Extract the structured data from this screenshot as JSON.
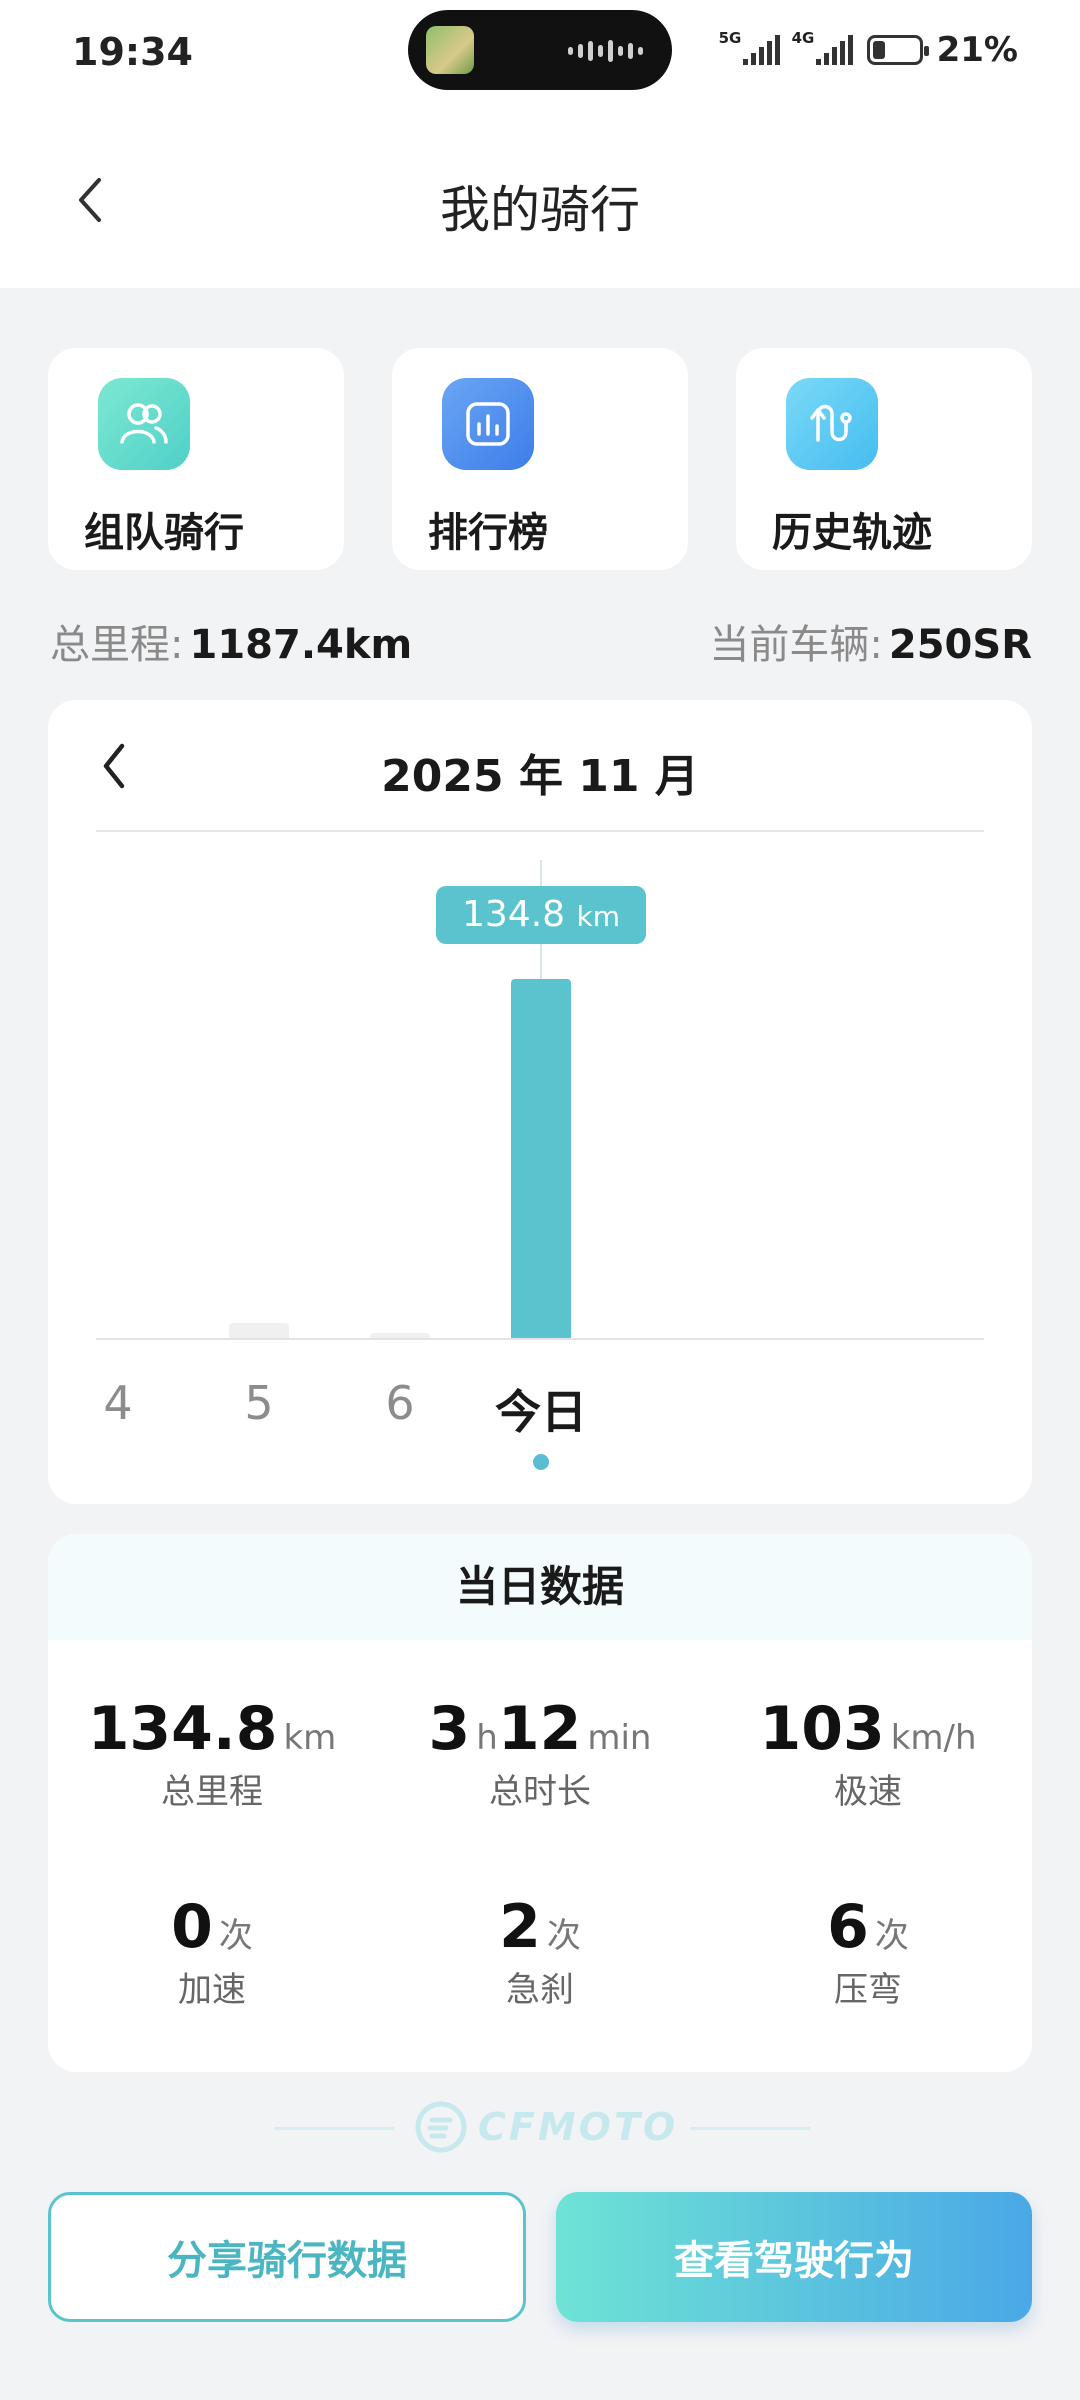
{
  "status": {
    "time": "19:34",
    "net1": "5G",
    "net2": "4G",
    "battery": "21%"
  },
  "header": {
    "title": "我的骑行"
  },
  "quick_actions": [
    {
      "label": "组队骑行",
      "icon": "team-ride-icon",
      "color": "#5fdcc9"
    },
    {
      "label": "排行榜",
      "icon": "leaderboard-icon",
      "color": "#4a8ef0"
    },
    {
      "label": "历史轨迹",
      "icon": "track-history-icon",
      "color": "#5cc8f0"
    }
  ],
  "totals": {
    "mileage_label": "总里程:",
    "mileage_value": "1187.4km",
    "vehicle_label": "当前车辆:",
    "vehicle_value": "250SR"
  },
  "chart_data": {
    "type": "bar",
    "title": "2025 年 11 月",
    "categories": [
      "4",
      "5",
      "6",
      "今日"
    ],
    "values": [
      0,
      5.5,
      2,
      134.8
    ],
    "selected_index": 3,
    "tooltip_value": "134.8",
    "tooltip_unit": "km",
    "ylim": [
      0,
      150
    ],
    "bar_color": "#5bc3cd",
    "inactive_color": "#f0f0f0"
  },
  "daily": {
    "title": "当日数据",
    "stats": [
      {
        "num": "134.8",
        "unit": "km",
        "label": "总里程"
      },
      {
        "num": "3",
        "unit": "h",
        "num2": "12",
        "unit2": "min",
        "label": "总时长"
      },
      {
        "num": "103",
        "unit": "km/h",
        "label": "极速"
      },
      {
        "num": "0",
        "unit": "次",
        "label": "加速"
      },
      {
        "num": "2",
        "unit": "次",
        "label": "急刹"
      },
      {
        "num": "6",
        "unit": "次",
        "label": "压弯"
      }
    ]
  },
  "brand": {
    "name": "CFMOTO"
  },
  "buttons": {
    "share": "分享骑行数据",
    "view": "查看驾驶行为"
  },
  "colors": {
    "accent": "#5bc3cd",
    "background": "#f2f3f5"
  }
}
